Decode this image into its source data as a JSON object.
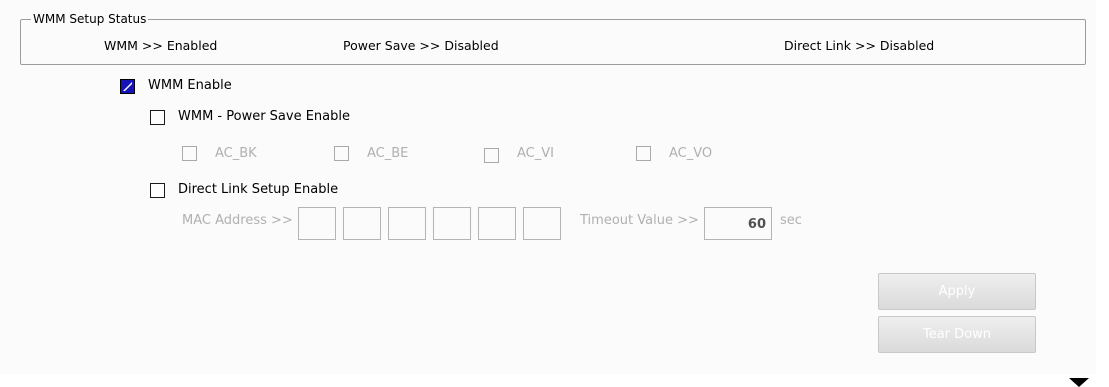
{
  "status_group": {
    "legend": "WMM Setup Status",
    "wmm": "WMM >> Enabled",
    "power_save": "Power Save >> Disabled",
    "direct_link": "Direct Link >> Disabled"
  },
  "wmm_enable": {
    "label": "WMM Enable",
    "checked": true
  },
  "power_save_enable": {
    "label": "WMM - Power Save Enable",
    "checked": false
  },
  "ac_options": [
    "AC_BK",
    "AC_BE",
    "AC_VI",
    "AC_VO"
  ],
  "direct_link_enable": {
    "label": "Direct Link Setup Enable",
    "checked": false
  },
  "mac": {
    "label": "MAC Address >>",
    "octets": [
      "",
      "",
      "",
      "",
      "",
      ""
    ]
  },
  "timeout": {
    "label": "Timeout Value >>",
    "value": "60",
    "unit": "sec"
  },
  "buttons": {
    "apply": "Apply",
    "tear_down": "Tear Down"
  },
  "colors": {
    "checked_fill": "#1414b8",
    "disabled_text": "#b0b0b0",
    "border": "#9c9c9c"
  }
}
